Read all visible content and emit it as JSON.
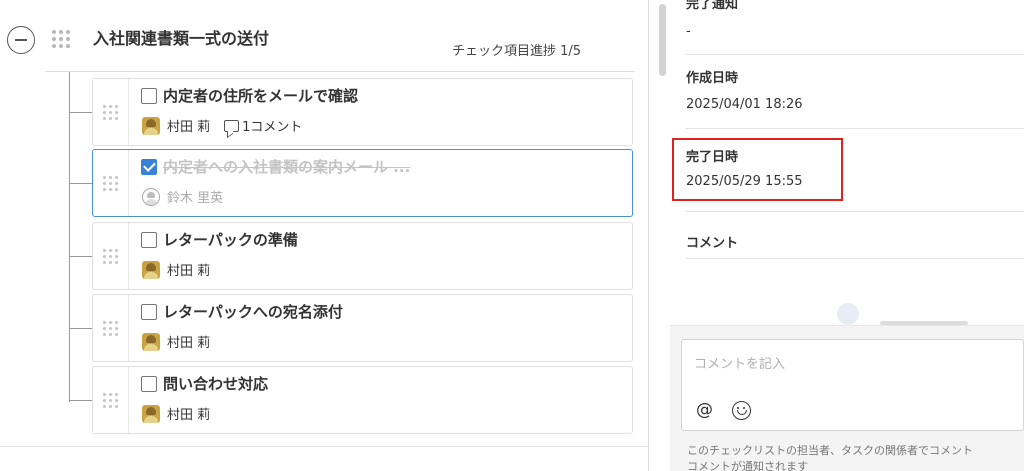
{
  "checklist": {
    "group_title": "入社関連書類一式の送付",
    "progress_text": "チェック項目進捗 1/5",
    "items": [
      {
        "title": "内定者の住所をメールで確認",
        "checked": false,
        "assignee": "村田 莉",
        "comment_count": "1コメント"
      },
      {
        "title": "内定者への入社書類の案内メール ...",
        "checked": true,
        "assignee": "鈴木 里英",
        "comment_count": ""
      },
      {
        "title": "レターパックの準備",
        "checked": false,
        "assignee": "村田 莉",
        "comment_count": ""
      },
      {
        "title": "レターパックへの宛名添付",
        "checked": false,
        "assignee": "村田 莉",
        "comment_count": ""
      },
      {
        "title": "問い合わせ対応",
        "checked": false,
        "assignee": "村田 莉",
        "comment_count": ""
      }
    ]
  },
  "details": {
    "completion_notice_label": "完了通知",
    "completion_notice_value": "-",
    "created_label": "作成日時",
    "created_value": "2025/04/01 18:26",
    "completed_label": "完了日時",
    "completed_value": "2025/05/29 15:55",
    "comment_label": "コメント"
  },
  "composer": {
    "placeholder": "コメントを記入",
    "mention_label": "@",
    "note_line1": "このチェックリストの担当者、タスクの関係者でコメント",
    "note_line2": "コメントが通知されます"
  },
  "colors": {
    "accent": "#3a82d6",
    "highlight": "#e0221f"
  }
}
